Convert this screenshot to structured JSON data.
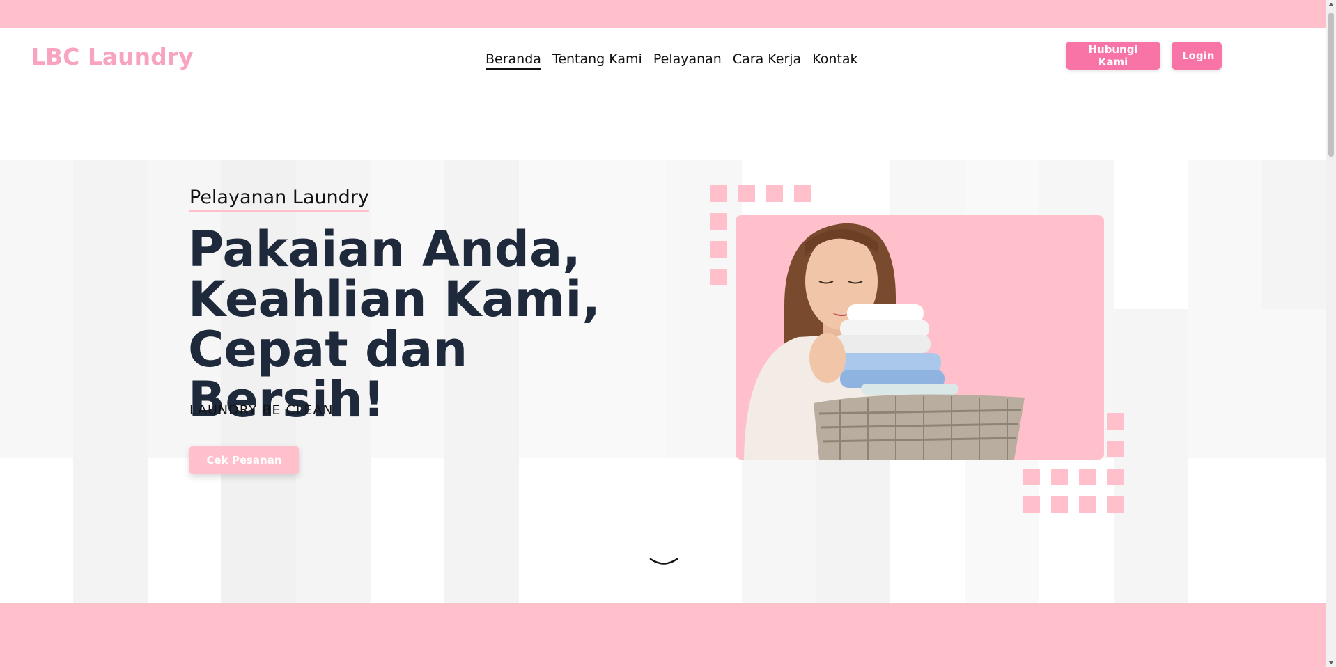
{
  "brand": {
    "logo": "LBC Laundry",
    "accent": "#ffc0cb",
    "button_color": "#f874a7",
    "logo_color": "#f8a3c0",
    "heading_color": "#1e293b"
  },
  "nav": {
    "links": [
      {
        "label": "Beranda",
        "active": true
      },
      {
        "label": "Tentang Kami",
        "active": false
      },
      {
        "label": "Pelayanan",
        "active": false
      },
      {
        "label": "Cara Kerja",
        "active": false
      },
      {
        "label": "Kontak",
        "active": false
      }
    ],
    "contact_button": "Hubungi Kami",
    "login_button": "Login"
  },
  "hero": {
    "eyebrow": "Pelayanan Laundry",
    "headline_lines": [
      "Pakaian Anda,",
      "Keahlian Kami,",
      "Cepat dan Bersih!"
    ],
    "tagline": "LAUNDRY BE CLEAN",
    "cta_button": "Cek Pesanan",
    "image_icon": "woman-holding-laundry-basket-photo",
    "scroll_icon": "chevron-down-icon"
  }
}
